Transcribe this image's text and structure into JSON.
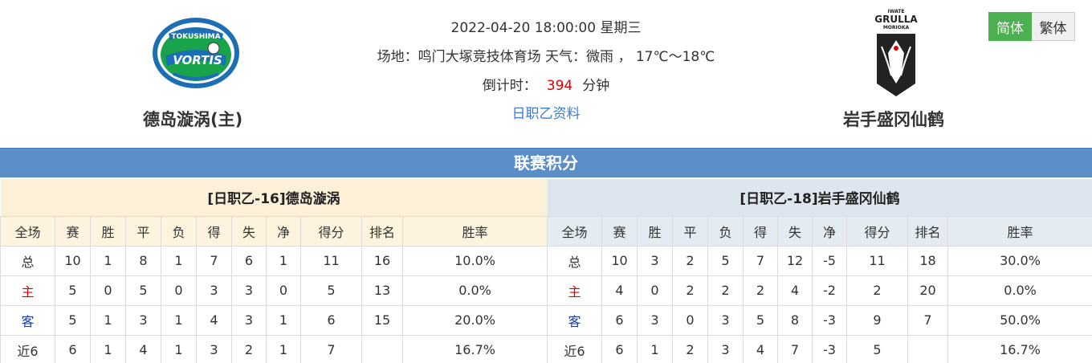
{
  "match": {
    "datetime": "2022-04-20 18:00:00 星期三",
    "venue_line": "场地：鸣门大塚竞技体育场 天气：微雨 ， 17℃～18℃",
    "countdown_label": "倒计时：",
    "countdown_value": "394",
    "countdown_unit": "分钟",
    "league_link": "日职乙资料"
  },
  "home_team": {
    "name": "德岛漩涡(主)",
    "logo_text_top": "TOKUSHIMA",
    "logo_text": "VORTIS"
  },
  "away_team": {
    "name": "岩手盛冈仙鹤",
    "logo_text_top": "IWATE",
    "logo_text": "GRULLA",
    "logo_text_bottom": "MORIOKA"
  },
  "lang": {
    "simplified": "简体",
    "traditional": "繁体"
  },
  "section_title": "联赛积分",
  "colors": {
    "section_bar": "#5b8ec9",
    "lang_active": "#4caf50",
    "countdown": "#dd0000",
    "link": "#3a7bd5"
  },
  "standings": {
    "headers": [
      "全场",
      "赛",
      "胜",
      "平",
      "负",
      "得",
      "失",
      "净",
      "得分",
      "排名",
      "胜率"
    ],
    "home": {
      "title": "[日职乙-16]德岛漩涡",
      "rows": [
        [
          "总",
          "10",
          "1",
          "8",
          "1",
          "7",
          "6",
          "1",
          "11",
          "16",
          "10.0%"
        ],
        [
          "主",
          "5",
          "0",
          "5",
          "0",
          "3",
          "3",
          "0",
          "5",
          "13",
          "0.0%"
        ],
        [
          "客",
          "5",
          "1",
          "3",
          "1",
          "4",
          "3",
          "1",
          "6",
          "15",
          "20.0%"
        ],
        [
          "近6",
          "6",
          "1",
          "4",
          "1",
          "3",
          "2",
          "1",
          "7",
          "",
          "16.7%"
        ]
      ]
    },
    "away": {
      "title": "[日职乙-18]岩手盛冈仙鹤",
      "rows": [
        [
          "总",
          "10",
          "3",
          "2",
          "5",
          "7",
          "12",
          "-5",
          "11",
          "18",
          "30.0%"
        ],
        [
          "主",
          "4",
          "0",
          "2",
          "2",
          "2",
          "4",
          "-2",
          "2",
          "20",
          "0.0%"
        ],
        [
          "客",
          "6",
          "3",
          "0",
          "3",
          "5",
          "8",
          "-3",
          "9",
          "7",
          "50.0%"
        ],
        [
          "近6",
          "6",
          "1",
          "2",
          "3",
          "4",
          "7",
          "-3",
          "5",
          "",
          "16.7%"
        ]
      ]
    }
  }
}
